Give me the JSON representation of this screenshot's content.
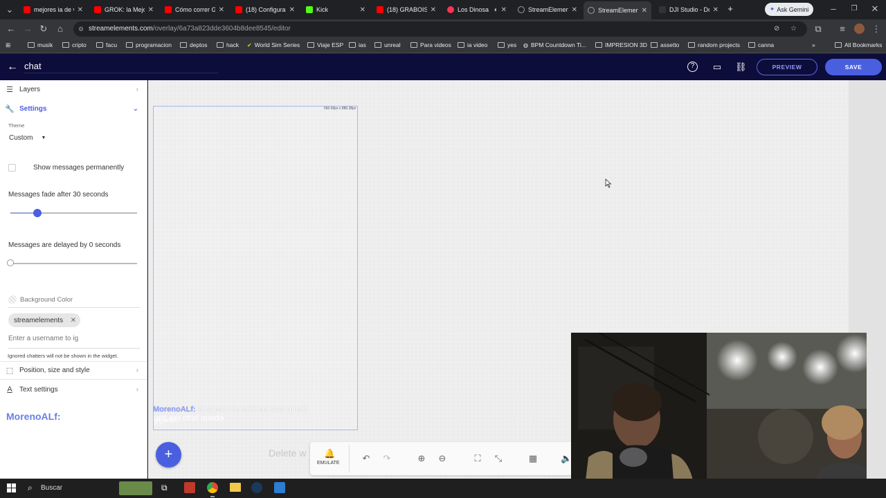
{
  "browser": {
    "tabs": [
      {
        "title": "mejores ia de v",
        "color": "#ff0000"
      },
      {
        "title": "GROK: la Mejor",
        "color": "#ff0000"
      },
      {
        "title": "Cómo correr Gr",
        "color": "#ff0000"
      },
      {
        "title": "(18) Configurar",
        "color": "#ff0000"
      },
      {
        "title": "Kick",
        "color": "#53fc18"
      },
      {
        "title": "(18) GRABOIS",
        "color": "#ff0000"
      },
      {
        "title": "Los Dinosa",
        "color": "#ff3355"
      },
      {
        "title": "StreamElement",
        "color": "#9aa0a6"
      },
      {
        "title": "StreamElement",
        "color": "#9aa0a6"
      },
      {
        "title": "DJI Studio - Do",
        "color": "#333333"
      }
    ],
    "ask_gemini": "Ask Gemini",
    "url_host": "streamelements.com",
    "url_path": "/overlay/6a73a823dde3604b8dee8545/editor",
    "bookmarks": [
      "musik",
      "cripto",
      "facu",
      "programacion",
      "deptos",
      "hack",
      "World Sim Series",
      "Viaje ESP",
      "ias",
      "unreal",
      "Para videos",
      "ia video",
      "yes",
      "BPM Countdown Ti...",
      "IMPRESION 3D",
      "assetto",
      "random projects",
      "canna"
    ],
    "all_bookmarks": "All Bookmarks"
  },
  "app": {
    "title": "chat",
    "preview_label": "PREVIEW",
    "save_label": "SAVE",
    "accent": "#4a5fe0",
    "header_bg": "#0d0d3b"
  },
  "sidebar": {
    "layers_label": "Layers",
    "settings_label": "Settings",
    "theme_label": "Theme",
    "theme_value": "Custom",
    "show_permanent_label": "Show messages permanently",
    "fade_label": "Messages fade after 30 seconds",
    "fade_seconds": 30,
    "delay_label": "Messages are delayed by 0 seconds",
    "delay_seconds": 0,
    "bg_color_label": "Background Color",
    "ignored_chip": "streamelements",
    "username_placeholder": "Enter a username to ig",
    "ignored_hint": "Ignored chatters will not be shown in the widget.",
    "position_label": "Position, size and style",
    "text_settings_label": "Text settings",
    "preview_user": "MorenoALf:"
  },
  "canvas": {
    "size_label": "560.69px x 886.38px",
    "chat_user": "MorenoALf:",
    "chat_message": "el stream de tomi eel chat queda",
    "chat_ghost_line": "omi eel chat queda",
    "chat_ghost_word": "gigante",
    "delete_hint": "Delete w"
  },
  "toolbar": {
    "emulate_label": "EMULATE"
  },
  "taskbar": {
    "search_label": "Buscar"
  }
}
